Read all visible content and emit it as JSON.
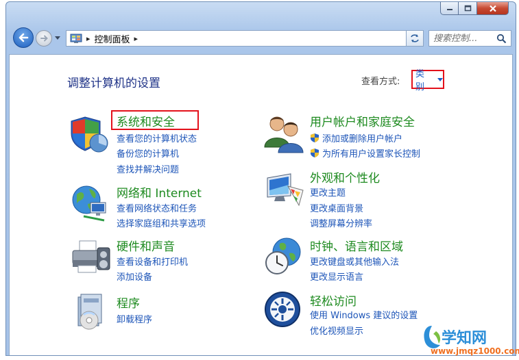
{
  "window": {
    "buttons": {
      "minimize": "minimize-icon",
      "maximize": "maximize-icon",
      "close": "close-icon"
    }
  },
  "toolbar": {
    "breadcrumb_item": "控制面板",
    "search_placeholder": "搜索控制..."
  },
  "main": {
    "title": "调整计算机的设置",
    "view_by_label": "查看方式:",
    "view_by_value": "类别"
  },
  "categories": [
    {
      "title": "系统和安全",
      "icon": "security-shield-icon",
      "links": [
        "查看您的计算机状态",
        "备份您的计算机",
        "查找并解决问题"
      ]
    },
    {
      "title": "网络和 Internet",
      "icon": "network-globe-icon",
      "links": [
        "查看网络状态和任务",
        "选择家庭组和共享选项"
      ]
    },
    {
      "title": "硬件和声音",
      "icon": "printer-icon",
      "links": [
        "查看设备和打印机",
        "添加设备"
      ]
    },
    {
      "title": "程序",
      "icon": "programs-icon",
      "links": [
        "卸载程序"
      ]
    },
    {
      "title": "用户帐户和家庭安全",
      "icon": "users-icon",
      "links": [
        "添加或删除用户帐户",
        "为所有用户设置家长控制"
      ]
    },
    {
      "title": "外观和个性化",
      "icon": "display-palette-icon",
      "links": [
        "更改主题",
        "更改桌面背景",
        "调整屏幕分辨率"
      ]
    },
    {
      "title": "时钟、语言和区域",
      "icon": "clock-globe-icon",
      "links": [
        "更改键盘或其他输入法",
        "更改显示语言"
      ]
    },
    {
      "title": "轻松访问",
      "icon": "ease-of-access-icon",
      "links": [
        "使用 Windows 建议的设置",
        "优化视频显示"
      ]
    }
  ],
  "watermark": {
    "name": "学知网",
    "url": "www.jmqz1000.com"
  }
}
